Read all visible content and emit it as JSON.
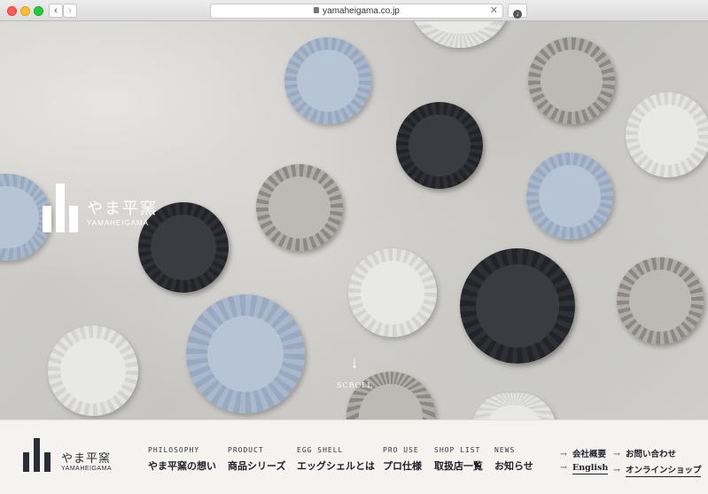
{
  "browser": {
    "url": "yamaheigama.co.jp",
    "back_label": "‹",
    "forward_label": "›",
    "clear_label": "✕",
    "download_label": "↓"
  },
  "hero": {
    "brand_name": "やま平窯",
    "brand_roman": "YAMAHEIGAMA",
    "scroll_label": "SCROLL",
    "scroll_arrow": "↓"
  },
  "footer": {
    "brand_name": "やま平窯",
    "brand_roman": "YAMAHEIGAMA",
    "nav": [
      {
        "en": "PHILOSOPHY",
        "ja": "やま平窯の想い"
      },
      {
        "en": "PRODUCT",
        "ja": "商品シリーズ"
      },
      {
        "en": "EGG SHELL",
        "ja": "エッグシェルとは"
      },
      {
        "en": "PRO USE",
        "ja": "プロ仕様"
      },
      {
        "en": "SHOP LIST",
        "ja": "取扱店一覧"
      },
      {
        "en": "NEWS",
        "ja": "お知らせ"
      }
    ],
    "util": {
      "arrow": "→",
      "company": "会社概要",
      "contact": "お問い合わせ",
      "english": "English",
      "shop": "オンラインショップ"
    }
  }
}
